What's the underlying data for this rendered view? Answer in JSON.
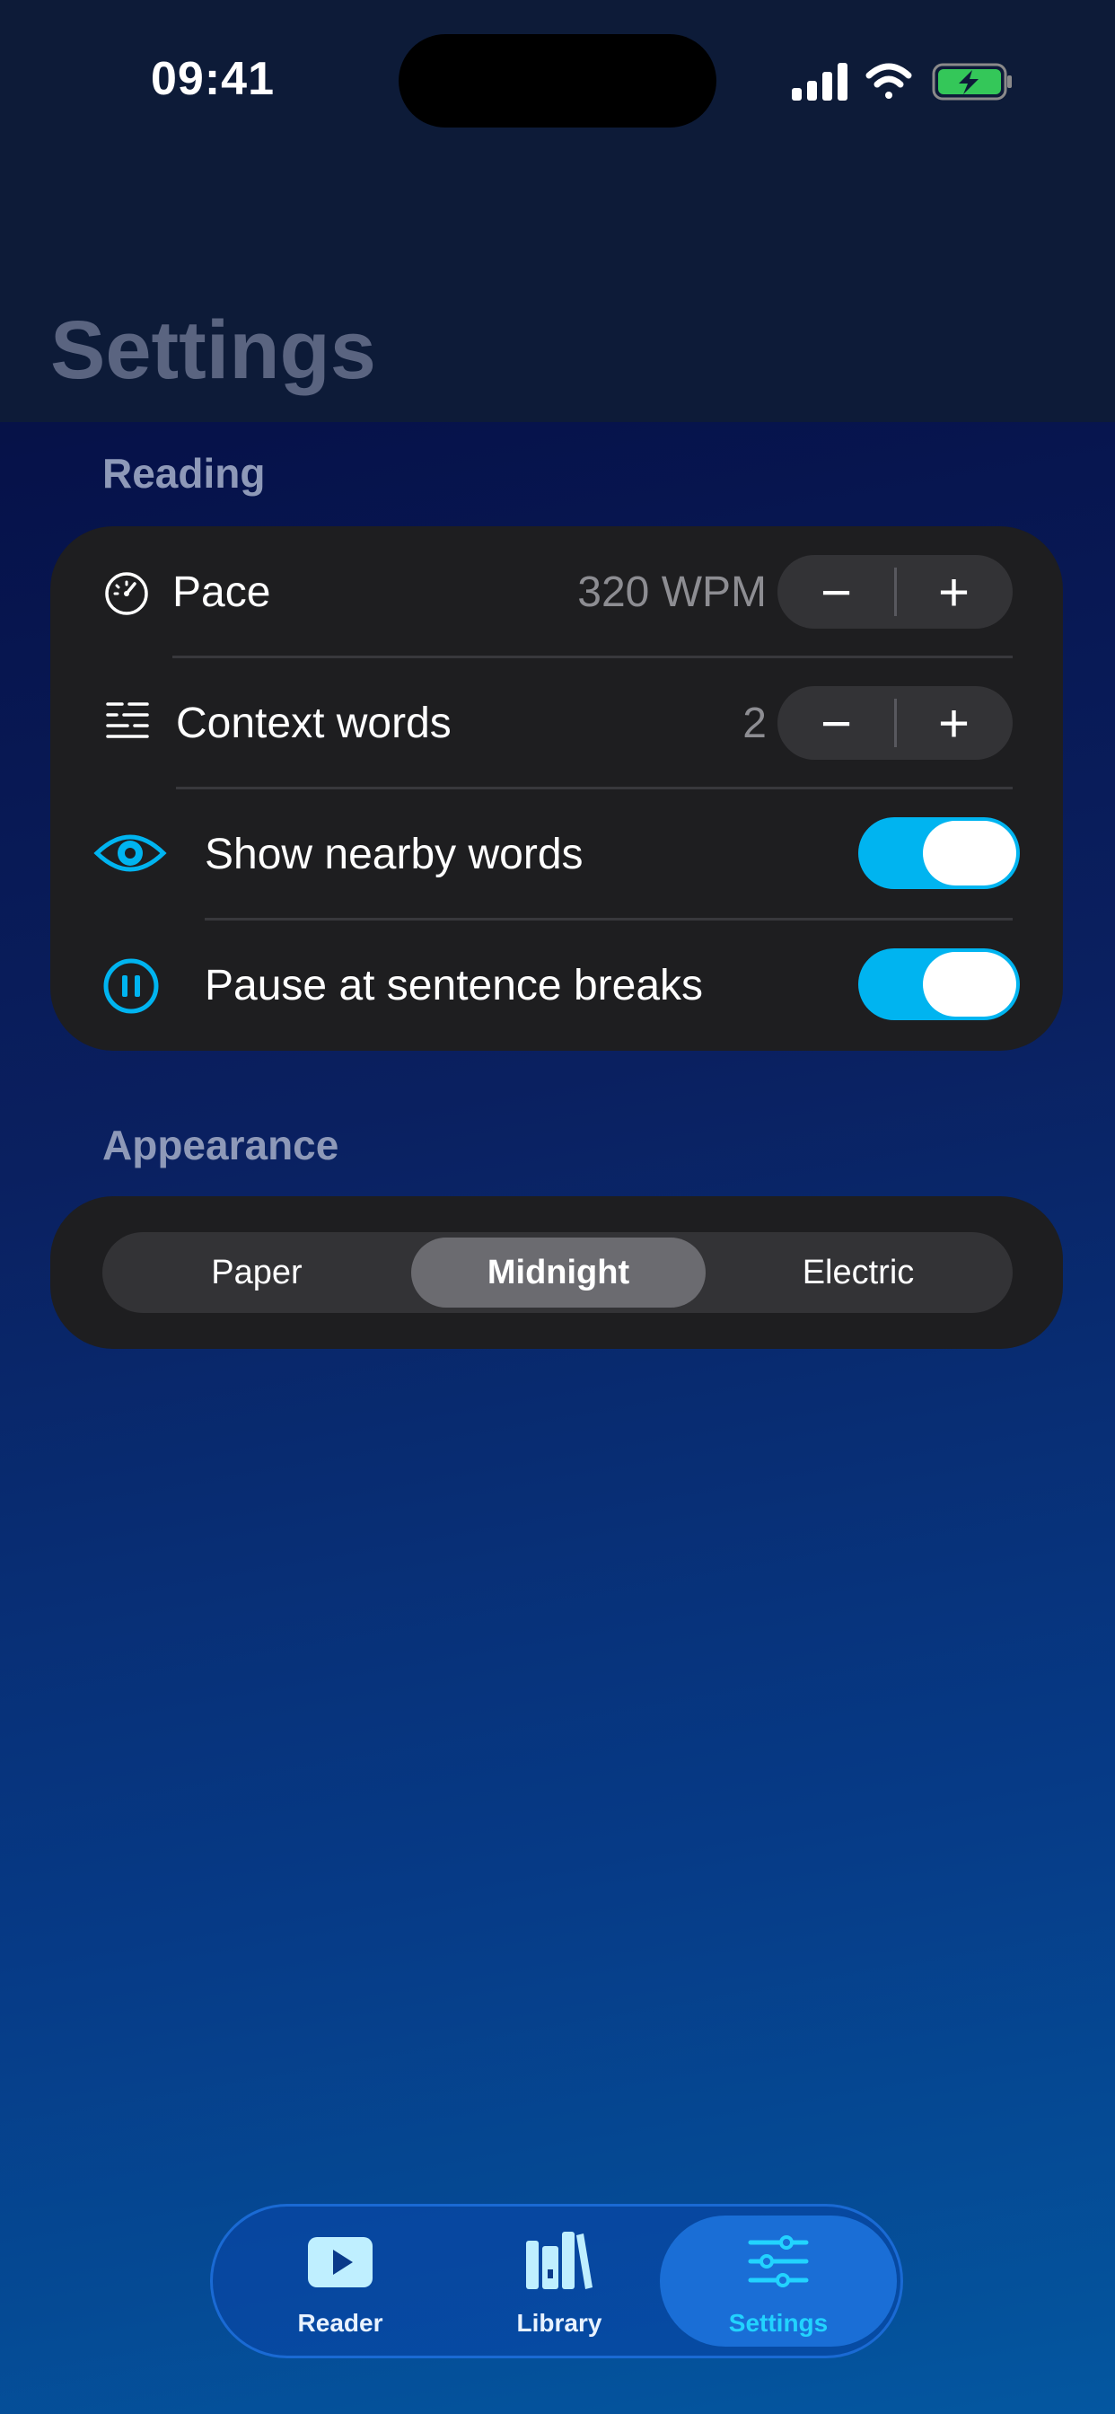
{
  "status_bar": {
    "time": "09:41"
  },
  "header": {
    "title": "Settings"
  },
  "reading": {
    "section_label": "Reading",
    "pace": {
      "label": "Pace",
      "value": "320 WPM",
      "decrement": "−",
      "increment": "+"
    },
    "context_words": {
      "label": "Context words",
      "value": "2",
      "decrement": "−",
      "increment": "+"
    },
    "show_nearby_words": {
      "label": "Show nearby words",
      "on": true
    },
    "pause_at_sentence_breaks": {
      "label": "Pause at sentence breaks",
      "on": true
    }
  },
  "appearance": {
    "section_label": "Appearance",
    "options": [
      "Paper",
      "Midnight",
      "Electric"
    ],
    "selected": "Midnight"
  },
  "tabbar": {
    "tabs": [
      {
        "label": "Reader",
        "icon": "play-icon"
      },
      {
        "label": "Library",
        "icon": "books-icon"
      },
      {
        "label": "Settings",
        "icon": "sliders-icon"
      }
    ],
    "active": "Settings"
  },
  "colors": {
    "accent": "#00b4f0",
    "card": "#1e1e20",
    "active_tab": "#1a6ed6",
    "active_tab_label": "#22d3ff"
  }
}
